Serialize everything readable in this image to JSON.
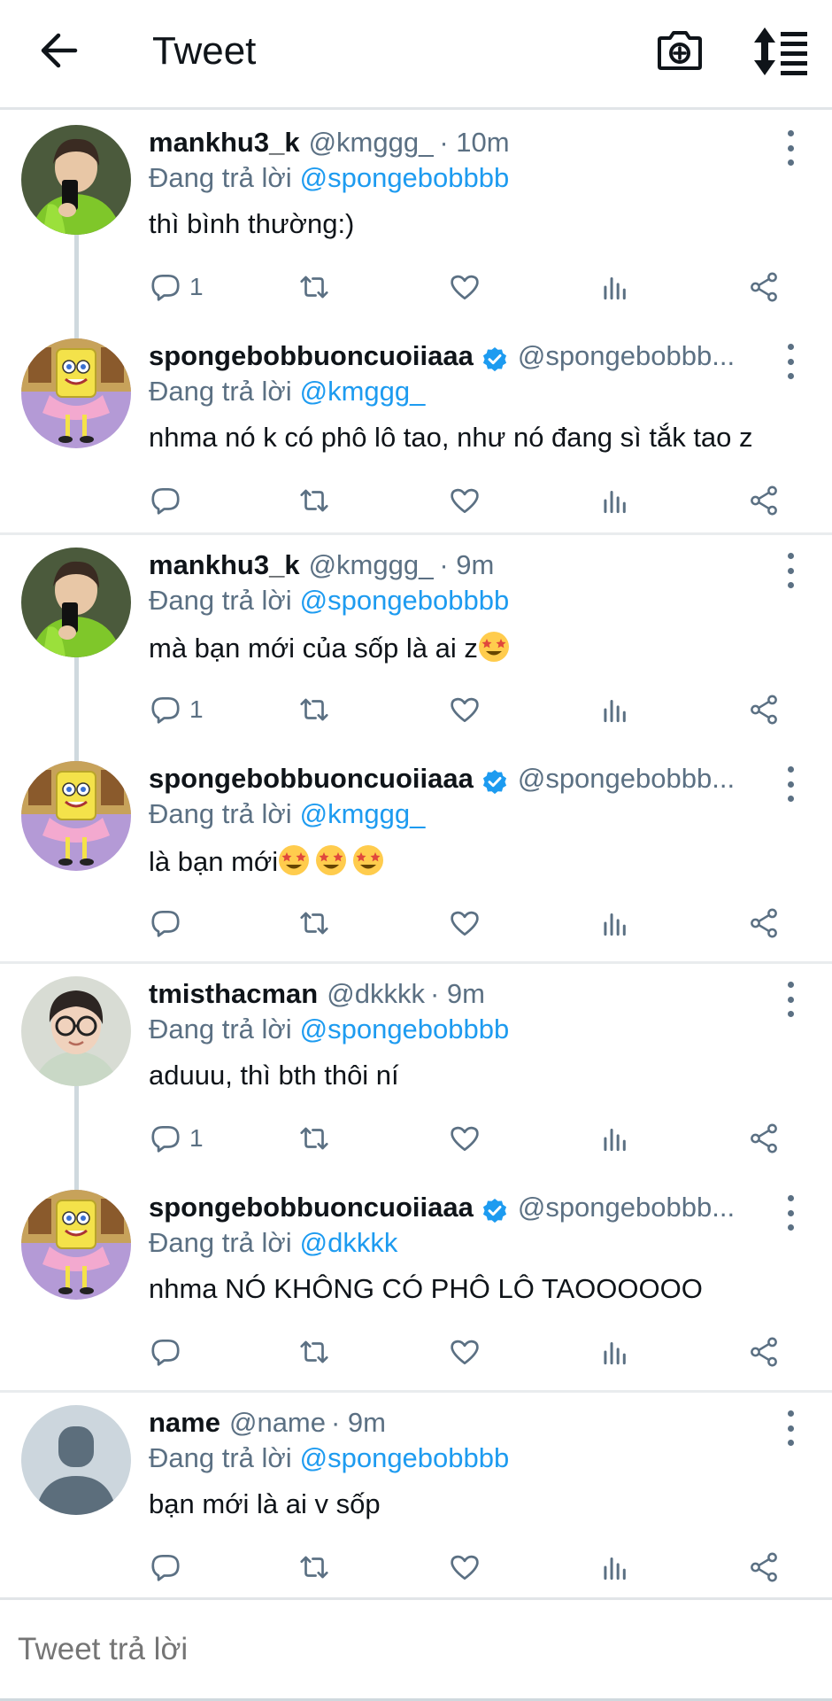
{
  "header": {
    "title": "Tweet",
    "back_icon": "arrow-left-icon",
    "camera_icon": "camera-add-icon",
    "sort_icon": "sort-list-icon"
  },
  "reply_prefix": "Đang trả lời",
  "threads": [
    {
      "tweets": [
        {
          "display_name": "mankhu3_k",
          "verified": false,
          "handle": "@kmggg_",
          "time": "· 10m",
          "reply_to": "@spongebobbbb",
          "text": "thì bình thường:)",
          "emoji_count": 0,
          "reply_count": "1",
          "avatar": "person-green-jacket-selfie"
        },
        {
          "display_name": "spongebobbuoncuoiiaaa",
          "verified": true,
          "handle": "@spongebobbb...",
          "time": "",
          "reply_to": "@kmggg_",
          "text": "nhma nó k có phô lô tao, như nó đang sì tắk tao z",
          "emoji_count": 0,
          "reply_count": "",
          "avatar": "spongebob-tutu"
        }
      ]
    },
    {
      "tweets": [
        {
          "display_name": "mankhu3_k",
          "verified": false,
          "handle": "@kmggg_",
          "time": "· 9m",
          "reply_to": "@spongebobbbb",
          "text": "mà bạn mới của sốp là ai z",
          "emoji_count": 1,
          "reply_count": "1",
          "avatar": "person-green-jacket-selfie"
        },
        {
          "display_name": "spongebobbuoncuoiiaaa",
          "verified": true,
          "handle": "@spongebobbb...",
          "time": "",
          "reply_to": "@kmggg_",
          "text": "là bạn mới",
          "emoji_count": 3,
          "reply_count": "",
          "avatar": "spongebob-tutu"
        }
      ]
    },
    {
      "tweets": [
        {
          "display_name": "tmisthacman",
          "verified": false,
          "handle": "@dkkkk",
          "time": "· 9m",
          "reply_to": "@spongebobbbb",
          "text": "aduuu, thì bth thôi ní",
          "emoji_count": 0,
          "reply_count": "1",
          "avatar": "person-glasses"
        },
        {
          "display_name": "spongebobbuoncuoiiaaa",
          "verified": true,
          "handle": "@spongebobbb...",
          "time": "",
          "reply_to": "@dkkkk",
          "text": "nhma NÓ KHÔNG CÓ PHÔ LÔ TAOOOOOO",
          "emoji_count": 0,
          "reply_count": "",
          "avatar": "spongebob-tutu"
        }
      ]
    },
    {
      "tweets": [
        {
          "display_name": "name",
          "verified": false,
          "handle": "@name",
          "time": "· 9m",
          "reply_to": "@spongebobbbb",
          "text": "bạn mới là ai v sốp",
          "emoji_count": 0,
          "reply_count": "",
          "avatar": "default-profile"
        }
      ]
    }
  ],
  "compose": {
    "placeholder": "Tweet trả lời"
  },
  "colors": {
    "accent": "#1d9bf0",
    "secondary_text": "#5b7083",
    "primary_text": "#0f1419",
    "divider": "#e9ecee"
  }
}
